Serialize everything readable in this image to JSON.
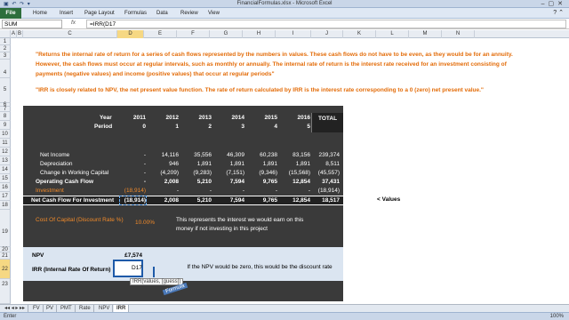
{
  "window": {
    "title": "FinancialFormulas.xlsx - Microsoft Excel"
  },
  "ribbon": {
    "file": "File",
    "tabs": [
      "Home",
      "Insert",
      "Page Layout",
      "Formulas",
      "Data",
      "Review",
      "View"
    ]
  },
  "formula_bar": {
    "name_box": "SUM",
    "fx": "fx",
    "formula": "=IRR(D17"
  },
  "columns": [
    "A",
    "B",
    "C",
    "D",
    "E",
    "F",
    "G",
    "H",
    "I",
    "J",
    "K",
    "L",
    "M",
    "N"
  ],
  "rows": [
    "1",
    "2",
    "3",
    "4",
    "5",
    "6",
    "7",
    "8",
    "9",
    "10",
    "11",
    "12",
    "13",
    "14",
    "15",
    "16",
    "17",
    "18",
    "19",
    "20",
    "21",
    "22",
    "23"
  ],
  "quotes": {
    "line1": "\"Returns the internal rate of return for a series of cash flows represented by the numbers in values. These cash flows do not have to be even, as they would be for an annuity.",
    "line2": "However, the cash flows must occur at regular intervals, such as monthly or annually. The internal rate of return is the interest rate received for an investment consisting of",
    "line3": "payments (negative values) and income (positive values) that occur at regular periods\"",
    "line4": "\"IRR is closely related to NPV, the net present value function. The rate of return calculated by IRR is the interest rate corresponding to a 0 (zero) net present value.\""
  },
  "table": {
    "year_label": "Year",
    "period_label": "Period",
    "total_label": "TOTAL",
    "years": [
      "2011",
      "2012",
      "2013",
      "2014",
      "2015",
      "2016"
    ],
    "periods": [
      "0",
      "1",
      "2",
      "3",
      "4",
      "5"
    ],
    "rows": [
      {
        "label": "Net Income",
        "values": [
          "-",
          "14,116",
          "35,556",
          "46,309",
          "60,238",
          "83,156"
        ],
        "total": "239,374"
      },
      {
        "label": "Depreciation",
        "values": [
          "-",
          "946",
          "1,891",
          "1,891",
          "1,891",
          "1,891"
        ],
        "total": "8,511"
      },
      {
        "label": "Change in Working Capital",
        "values": [
          "-",
          "(4,209)",
          "(9,283)",
          "(7,151)",
          "(9,346)",
          "(15,568)"
        ],
        "total": "(45,557)"
      },
      {
        "label": "Operating Cash Flow",
        "values": [
          "-",
          "2,008",
          "5,210",
          "7,594",
          "9,765",
          "12,854"
        ],
        "total": "37,431"
      },
      {
        "label": "Investment",
        "values": [
          "(18,914)",
          "-",
          "-",
          "-",
          "-",
          "-"
        ],
        "total": "(18,914)"
      },
      {
        "label": "Net Cash Flow For Investment",
        "values": [
          "(18,914)",
          "2,008",
          "5,210",
          "7,594",
          "9,765",
          "12,854"
        ],
        "total": "18,517"
      }
    ],
    "values_note": "< Values"
  },
  "cost_of_capital": {
    "label": "Cost Of Capital (Discount Rate %)",
    "value": "10.00%",
    "note": "This represents the interest we would earn on this money if not investing in this project"
  },
  "npv": {
    "label": "NPV",
    "value": "£7,574"
  },
  "irr": {
    "label": "IRR (Internal Rate Of Return)",
    "input": "D17",
    "tooltip": "IRR(values, [guess])",
    "note": "If the NPV would be zero, this would be the discount rate",
    "annotation": "Formula"
  },
  "sheets": [
    "FV",
    "PV",
    "PMT",
    "Rate",
    "NPV",
    "IRR"
  ],
  "status": {
    "mode": "Enter",
    "zoom": "100%"
  }
}
